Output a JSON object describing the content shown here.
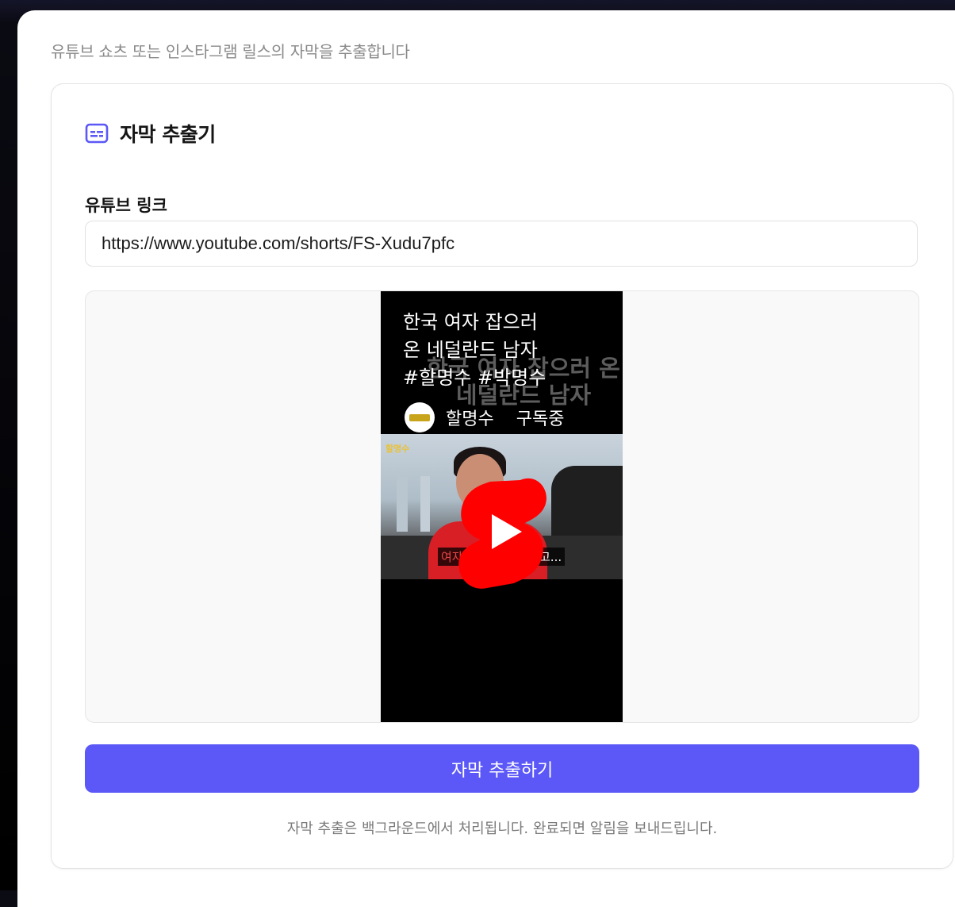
{
  "page": {
    "description": "유튜브 쇼츠 또는 인스타그램 릴스의 자막을 추출합니다"
  },
  "card": {
    "icon": "subtitles-icon",
    "title": "자막 추출기",
    "field_label": "유튜브 링크",
    "url_value": "https://www.youtube.com/shorts/FS-Xudu7pfc",
    "submit_label": "자막 추출하기",
    "footnote": "자막 추출은 백그라운드에서 처리됩니다. 완료되면 알림을 보내드립니다."
  },
  "video": {
    "title": "한국 여자 잡으러\n온 네덜란드 남자\n#할명수 #박명수",
    "overlay_title": "한국 여자 잡으러 온\n네덜란드 남자",
    "channel_name": "할명수",
    "subscribe_label": "구독중",
    "badge": "할명수",
    "caption_left": "여자",
    "caption_right": "고...",
    "play_icon": "youtube-shorts-play-icon"
  },
  "colors": {
    "accent": "#5b58f7",
    "shorts_red": "#ff0000"
  }
}
